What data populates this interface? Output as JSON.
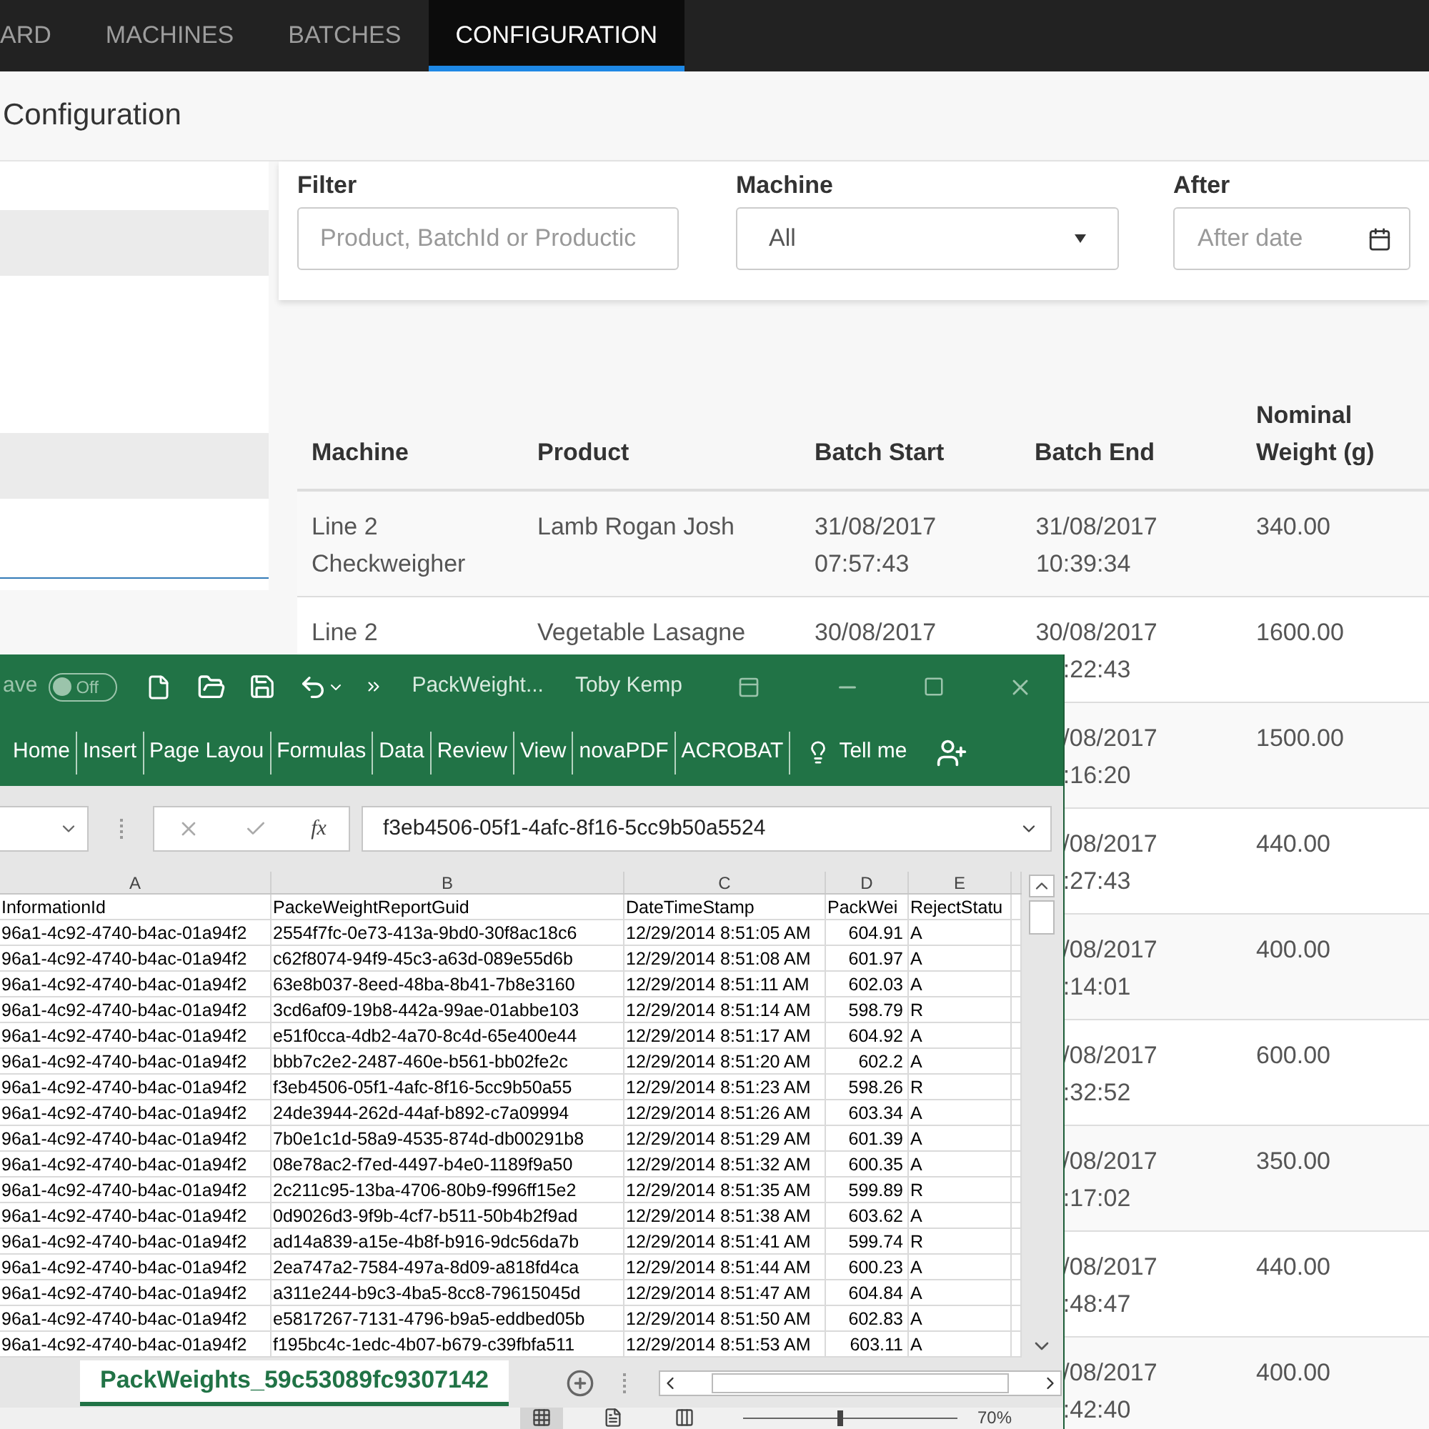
{
  "nav": {
    "tabs": [
      {
        "label": "ARD",
        "selected": false
      },
      {
        "label": "MACHINES",
        "selected": false
      },
      {
        "label": "BATCHES",
        "selected": false
      },
      {
        "label": "CONFIGURATION",
        "selected": true
      }
    ]
  },
  "page_title": "Configuration",
  "filters": {
    "filter": {
      "label": "Filter",
      "placeholder": "Product, BatchId or Productic"
    },
    "machine": {
      "label": "Machine",
      "value": "All"
    },
    "after": {
      "label": "After",
      "placeholder": "After date"
    }
  },
  "table": {
    "columns": [
      [
        "Machine"
      ],
      [
        "Product"
      ],
      [
        "Batch Start"
      ],
      [
        "Batch End"
      ],
      [
        "Nominal",
        "Weight (g)"
      ]
    ],
    "rows": [
      {
        "machine": [
          "Line 2",
          "Checkweigher"
        ],
        "product": [
          "Lamb Rogan Josh"
        ],
        "batch_start": [
          "31/08/2017",
          "07:57:43"
        ],
        "batch_end": [
          "31/08/2017",
          "10:39:34"
        ],
        "nominal": "340.00"
      },
      {
        "machine": [
          "Line 2"
        ],
        "product": [
          "Vegetable Lasagne"
        ],
        "batch_start": [
          "30/08/2017"
        ],
        "batch_end": [
          "30/08/2017",
          ":22:43"
        ],
        "nominal": "1600.00"
      },
      {
        "batch_end": [
          "/08/2017",
          ":16:20"
        ],
        "nominal": "1500.00"
      },
      {
        "batch_end": [
          "/08/2017",
          ":27:43"
        ],
        "nominal": "440.00"
      },
      {
        "batch_end": [
          "/08/2017",
          ":14:01"
        ],
        "nominal": "400.00"
      },
      {
        "batch_end": [
          "/08/2017",
          ":32:52"
        ],
        "nominal": "600.00"
      },
      {
        "batch_end": [
          "/08/2017",
          ":17:02"
        ],
        "nominal": "350.00"
      },
      {
        "batch_end": [
          "/08/2017",
          ":48:47"
        ],
        "nominal": "440.00"
      },
      {
        "batch_end": [
          "/08/2017",
          ":42:40"
        ],
        "nominal": "400.00"
      }
    ]
  },
  "excel": {
    "autosave": {
      "label": "ave",
      "toggle": "Off",
      "on": false
    },
    "title": "PackWeight...",
    "user": "Toby Kemp",
    "ribbon_tabs": [
      "Home",
      "Insert",
      "Page Layou",
      "Formulas",
      "Data",
      "Review",
      "View",
      "novaPDF",
      "ACROBAT"
    ],
    "tell_me": "Tell me",
    "formula": "f3eb4506-05f1-4afc-8f16-5cc9b50a5524",
    "columns": [
      "A",
      "B",
      "C",
      "D",
      "E"
    ],
    "rows": [
      [
        "InformationId",
        "PackeWeightReportGuid",
        "DateTimeStamp",
        "PackWei",
        "RejectStatu"
      ],
      [
        "96a1-4c92-4740-b4ac-01a94f2",
        "2554f7fc-0e73-413a-9bd0-30f8ac18c6",
        "12/29/2014 8:51:05 AM",
        "604.91",
        "A"
      ],
      [
        "96a1-4c92-4740-b4ac-01a94f2",
        "c62f8074-94f9-45c3-a63d-089e55d6b",
        "12/29/2014 8:51:08 AM",
        "601.97",
        "A"
      ],
      [
        "96a1-4c92-4740-b4ac-01a94f2",
        "63e8b037-8eed-48ba-8b41-7b8e3160",
        "12/29/2014 8:51:11 AM",
        "602.03",
        "A"
      ],
      [
        "96a1-4c92-4740-b4ac-01a94f2",
        "3cd6af09-19b8-442a-99ae-01abbe103",
        "12/29/2014 8:51:14 AM",
        "598.79",
        "R"
      ],
      [
        "96a1-4c92-4740-b4ac-01a94f2",
        "e51f0cca-4db2-4a70-8c4d-65e400e44",
        "12/29/2014 8:51:17 AM",
        "604.92",
        "A"
      ],
      [
        "96a1-4c92-4740-b4ac-01a94f2",
        "bbb7c2e2-2487-460e-b561-bb02fe2c",
        "12/29/2014 8:51:20 AM",
        "602.2",
        "A"
      ],
      [
        "96a1-4c92-4740-b4ac-01a94f2",
        "f3eb4506-05f1-4afc-8f16-5cc9b50a55",
        "12/29/2014 8:51:23 AM",
        "598.26",
        "R"
      ],
      [
        "96a1-4c92-4740-b4ac-01a94f2",
        "24de3944-262d-44af-b892-c7a09994",
        "12/29/2014 8:51:26 AM",
        "603.34",
        "A"
      ],
      [
        "96a1-4c92-4740-b4ac-01a94f2",
        "7b0e1c1d-58a9-4535-874d-db00291b8",
        "12/29/2014 8:51:29 AM",
        "601.39",
        "A"
      ],
      [
        "96a1-4c92-4740-b4ac-01a94f2",
        "08e78ac2-f7ed-4497-b4e0-1189f9a50",
        "12/29/2014 8:51:32 AM",
        "600.35",
        "A"
      ],
      [
        "96a1-4c92-4740-b4ac-01a94f2",
        "2c211c95-13ba-4706-80b9-f996ff15e2",
        "12/29/2014 8:51:35 AM",
        "599.89",
        "R"
      ],
      [
        "96a1-4c92-4740-b4ac-01a94f2",
        "0d9026d3-9f9b-4cf7-b511-50b4b2f9ad",
        "12/29/2014 8:51:38 AM",
        "603.62",
        "A"
      ],
      [
        "96a1-4c92-4740-b4ac-01a94f2",
        "ad14a839-a15e-4b8f-b916-9dc56da7b",
        "12/29/2014 8:51:41 AM",
        "599.74",
        "R"
      ],
      [
        "96a1-4c92-4740-b4ac-01a94f2",
        "2ea747a2-7584-497a-8d09-a818fd4ca",
        "12/29/2014 8:51:44 AM",
        "600.23",
        "A"
      ],
      [
        "96a1-4c92-4740-b4ac-01a94f2",
        "a311e244-b9c3-4ba5-8cc8-79615045d",
        "12/29/2014 8:51:47 AM",
        "604.84",
        "A"
      ],
      [
        "96a1-4c92-4740-b4ac-01a94f2",
        "e5817267-7131-4796-b9a5-eddbed05b",
        "12/29/2014 8:51:50 AM",
        "602.83",
        "A"
      ],
      [
        "96a1-4c92-4740-b4ac-01a94f2",
        "f195bc4c-1edc-4b07-b679-c39fbfa511",
        "12/29/2014 8:51:53 AM",
        "603.11",
        "A"
      ]
    ],
    "sheet_tabs": [
      {
        "label": "PackWeights_59c53089fc9307142",
        "selected": true
      }
    ],
    "view_buttons": [
      {
        "selected": true
      },
      {
        "selected": false
      },
      {
        "selected": false
      }
    ],
    "zoom_slider": {
      "level": 0.45
    },
    "function_label": "fx",
    "zoom": "70%"
  }
}
